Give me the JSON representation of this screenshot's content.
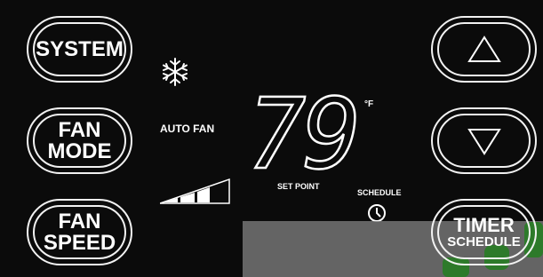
{
  "buttons": {
    "system": "SYSTEM",
    "fan_mode": [
      "FAN",
      "MODE"
    ],
    "fan_speed": [
      "FAN",
      "SPEED"
    ],
    "timer_schedule": [
      "TIMER",
      "SCHEDULE"
    ]
  },
  "display": {
    "fan_mode_text": "AUTO FAN",
    "temperature": "79",
    "unit": "°F",
    "setpoint_label": "SET POINT",
    "schedule_label": "SCHEDULE"
  },
  "icons": {
    "mode_icon": "snowflake-icon",
    "fan_speed_indicator": "fan-speed-bars-icon",
    "schedule_icon": "clock-icon",
    "up": "triangle-up-icon",
    "down": "triangle-down-icon"
  },
  "fan_speed_level": {
    "filled": 3,
    "total": 4
  },
  "colors": {
    "background": "#0b0b0b",
    "foreground": "#ffffff"
  }
}
